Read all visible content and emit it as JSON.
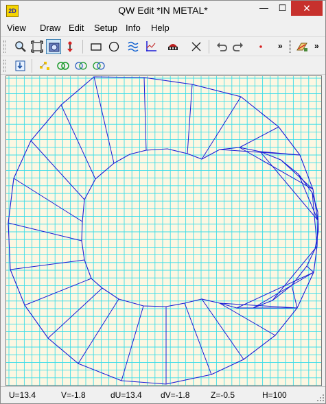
{
  "window": {
    "app_icon_text": "2D",
    "title": "QW Edit   *IN METAL*",
    "minimize": "—",
    "maximize": "☐",
    "close": "✕"
  },
  "menu": [
    {
      "label": "View"
    },
    {
      "label": "Draw"
    },
    {
      "label": "Edit"
    },
    {
      "label": "Setup"
    },
    {
      "label": "Info"
    },
    {
      "label": "Help"
    }
  ],
  "toolbar": {
    "overflow_1": "»",
    "overflow_2": "»",
    "overflow_3": "»",
    "icons_row1": [
      "zoom-icon",
      "zoom-extents-icon",
      "view-all-icon",
      "probe-icon",
      "rectangle-icon",
      "circle-icon",
      "mesh-fill-icon",
      "axes-icon",
      "port-icon",
      "delete-icon",
      "undo-icon",
      "redo-icon",
      "point-icon",
      "layers-icon"
    ],
    "icons_row2": [
      "import-icon",
      "nodes-icon",
      "rings-green-icon",
      "rings-blue-icon",
      "rings-mixed-icon"
    ]
  },
  "colors": {
    "grid": "#3ddde8",
    "background": "#fdf7e2",
    "mesh": "#1a1ad6",
    "close_button": "#c7312d"
  },
  "status": {
    "u": "U=13.4",
    "v": "V=-1.8",
    "du": "dU=13.4",
    "dv": "dV=-1.8",
    "z": "Z=-0.5",
    "h": "H=100"
  }
}
